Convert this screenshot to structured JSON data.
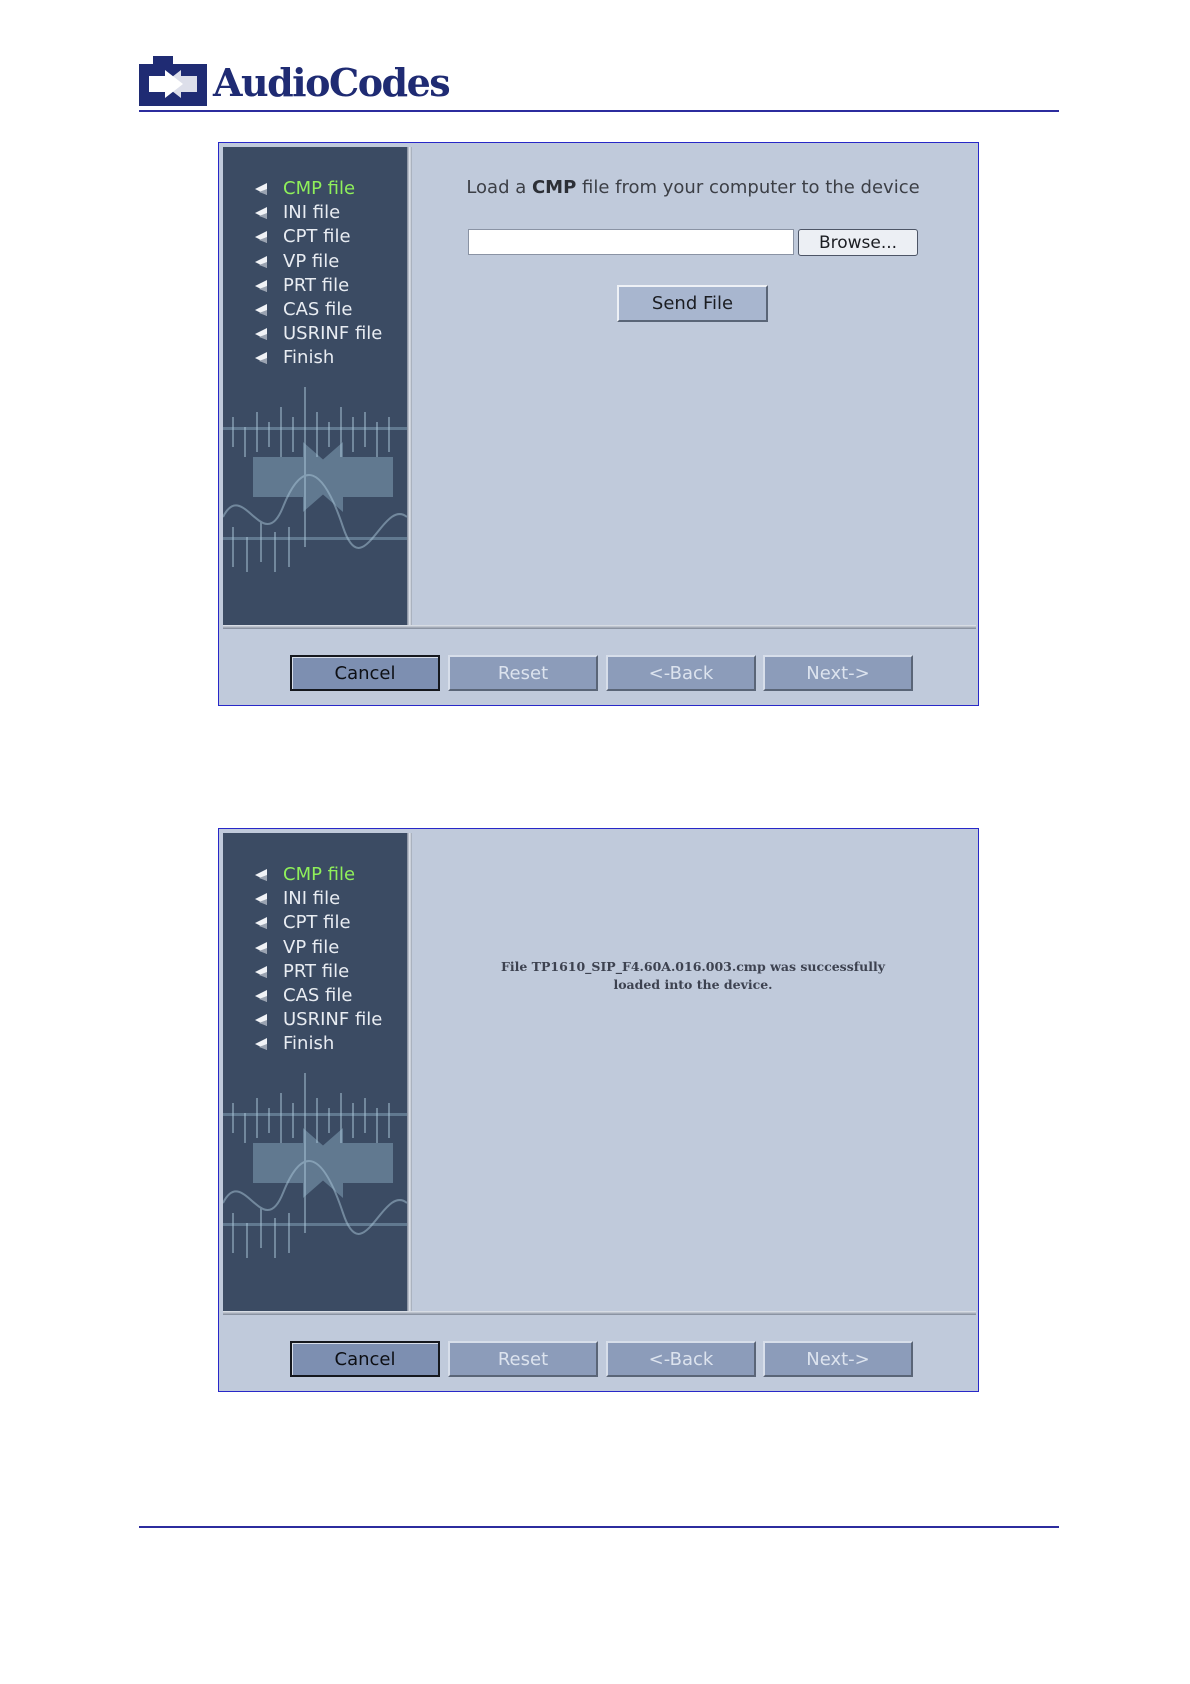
{
  "brand": {
    "name": "AudioCodes"
  },
  "nav_items": [
    "CMP file",
    "INI file",
    "CPT file",
    "VP file",
    "PRT file",
    "CAS file",
    "USRINF file",
    "Finish"
  ],
  "active_nav_index": 0,
  "upload": {
    "prompt_pre": "Load a ",
    "prompt_bold": "CMP",
    "prompt_post": " file from your computer to the device",
    "file_value": "",
    "browse_label": "Browse...",
    "send_label": "Send File"
  },
  "result": {
    "line1": "File TP1610_SIP_F4.60A.016.003.cmp was successfully",
    "line2": "loaded into the device."
  },
  "footer_buttons": {
    "cancel": "Cancel",
    "reset": "Reset",
    "back": "<-Back",
    "next": "Next->"
  },
  "colors": {
    "brand": "#1f2b73",
    "sidebar_bg": "#3b4b63",
    "panel_bg": "#c0cadb",
    "active_nav": "#8ff05a",
    "frame_border": "#2828c8"
  }
}
